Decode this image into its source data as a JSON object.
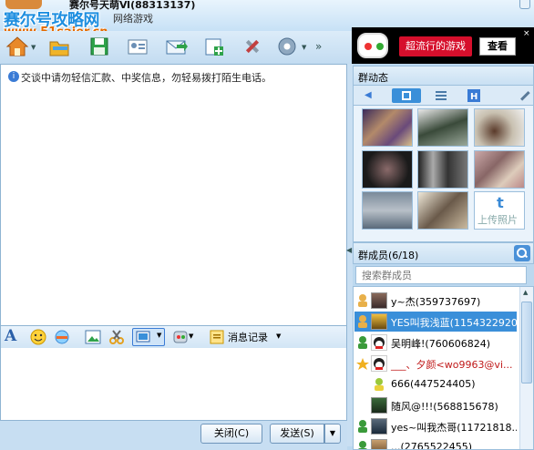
{
  "title": {
    "name": "赛尔号天萌Ⅵ(88313137)",
    "subtitle": "网络游戏"
  },
  "watermark": {
    "brand": "赛尔号攻略网",
    "url": "www.51saier.cn"
  },
  "ad": {
    "label": "超流行的游戏",
    "button": "查看",
    "close": "×"
  },
  "chat": {
    "notice": "交谈中请勿轻信汇款、中奖信息，勿轻易拨打陌生电话。"
  },
  "input_toolbar": {
    "font_glyph": "A",
    "history_label": "消息记录"
  },
  "bottom": {
    "close_label": "关闭(C)",
    "send_label": "发送(S)"
  },
  "right_panel": {
    "group_dynamics_label": "群动态",
    "upload_label": "上传照片",
    "members_label": "群成员(6/18)",
    "search_placeholder": "搜索群成员",
    "members": [
      {
        "name": "y~杰(359737697)",
        "icon": "admin-icon"
      },
      {
        "name": "YES叫我浅蓝(1154322920)",
        "icon": "admin-icon",
        "selected": true
      },
      {
        "name": "吴明峰!(760606824)",
        "icon": "member-icon"
      },
      {
        "name": "___、夕颜<wo9963@vi...",
        "icon": "owner-icon"
      },
      {
        "name": "666(447524405)",
        "icon": "member-icon"
      },
      {
        "name": "随风@!!!(568815678)",
        "icon": "member-icon"
      },
      {
        "name": "yes~叫我杰哥(11721818...",
        "icon": "member-icon"
      },
      {
        "name": "...(2765522455)",
        "icon": "member-icon"
      }
    ]
  },
  "colors": {
    "accent": "#3a8fd9",
    "ad_red": "#d60f2c",
    "chrome": "#bcd8ef"
  }
}
